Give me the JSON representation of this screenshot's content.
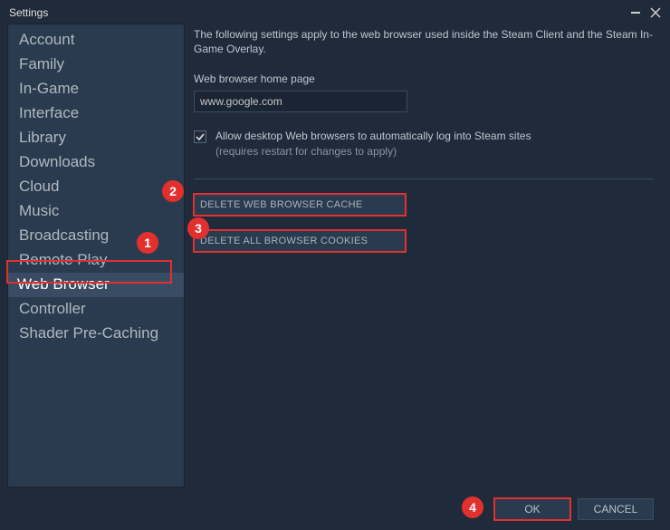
{
  "window": {
    "title": "Settings"
  },
  "sidebar": {
    "items": [
      {
        "label": "Account"
      },
      {
        "label": "Family"
      },
      {
        "label": "In-Game"
      },
      {
        "label": "Interface"
      },
      {
        "label": "Library"
      },
      {
        "label": "Downloads"
      },
      {
        "label": "Cloud"
      },
      {
        "label": "Music"
      },
      {
        "label": "Broadcasting"
      },
      {
        "label": "Remote Play"
      },
      {
        "label": "Web Browser"
      },
      {
        "label": "Controller"
      },
      {
        "label": "Shader Pre-Caching"
      }
    ],
    "selectedIndex": 10
  },
  "content": {
    "description": "The following settings apply to the web browser used inside the Steam Client and the Steam In-Game Overlay.",
    "homePageLabel": "Web browser home page",
    "homePageValue": "www.google.com",
    "allowDesktopLabel": "Allow desktop Web browsers to automatically log into Steam sites",
    "allowDesktopSub": "(requires restart for changes to apply)",
    "allowDesktopChecked": true,
    "deleteCacheLabel": "DELETE WEB BROWSER CACHE",
    "deleteCookiesLabel": "DELETE ALL BROWSER COOKIES"
  },
  "footer": {
    "ok": "OK",
    "cancel": "CANCEL"
  },
  "annotations": {
    "b1": "1",
    "b2": "2",
    "b3": "3",
    "b4": "4"
  }
}
